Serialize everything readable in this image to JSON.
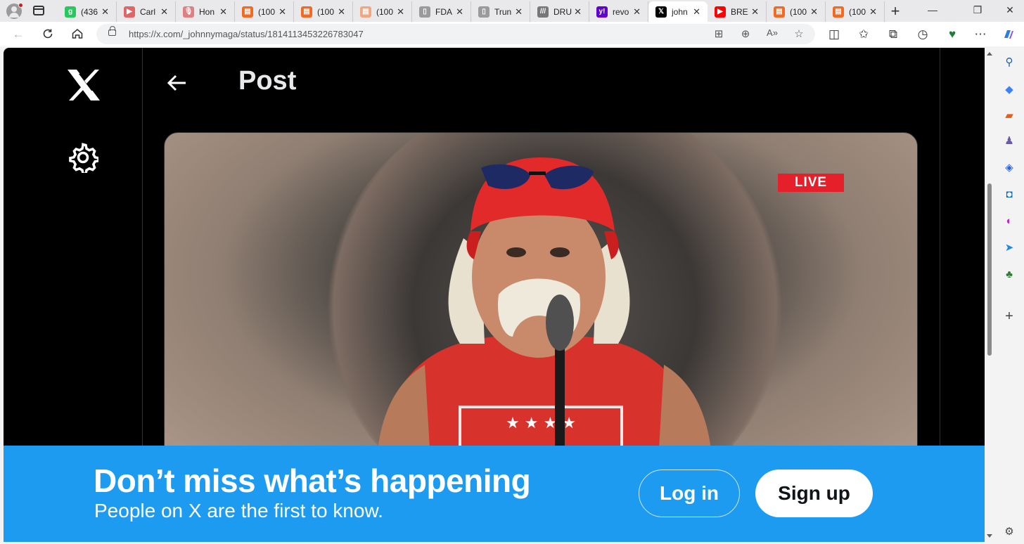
{
  "browser": {
    "tabs": [
      {
        "title": "(436",
        "favicon": "g",
        "color": "#27c95f"
      },
      {
        "title": "Carl",
        "favicon": "▶",
        "color": "#e06666"
      },
      {
        "title": "Hon",
        "favicon": "🎙",
        "color": "#e07f7f"
      },
      {
        "title": "(100",
        "favicon": "▤",
        "color": "#f26a21"
      },
      {
        "title": "(100",
        "favicon": "▤",
        "color": "#f26a21"
      },
      {
        "title": "(100",
        "favicon": "▤",
        "color": "#f0a882"
      },
      {
        "title": "FDA",
        "favicon": "▯",
        "color": "#9a9a9a"
      },
      {
        "title": "Trun",
        "favicon": "▯",
        "color": "#9a9a9a"
      },
      {
        "title": "DRU",
        "favicon": "///",
        "color": "#777777"
      },
      {
        "title": "revo",
        "favicon": "y!",
        "color": "#6001d2"
      },
      {
        "title": "john",
        "favicon": "𝕏",
        "color": "#000000",
        "active": true
      },
      {
        "title": "BRE",
        "favicon": "▶",
        "color": "#ff0000"
      },
      {
        "title": "(100",
        "favicon": "▤",
        "color": "#f26a21"
      },
      {
        "title": "(100",
        "favicon": "▤",
        "color": "#f26a21"
      }
    ],
    "new_tab": "+",
    "window_controls": {
      "minimize": "—",
      "restore": "❐",
      "close": "✕"
    },
    "url": "https://x.com/_johnnymaga/status/1814113453226783047"
  },
  "page": {
    "header_title": "Post",
    "live_badge": "LIVE",
    "banner": {
      "title": "Don’t miss what’s happening",
      "subtitle": "People on X are the first to know.",
      "login": "Log in",
      "signup": "Sign up"
    }
  },
  "colors": {
    "x_blue": "#1d9bf0",
    "live_red": "#e5202b",
    "page_bg": "#000000"
  },
  "icons": {
    "sidebar": [
      "search-icon",
      "tag-icon",
      "briefcase-icon",
      "games-icon",
      "copilot-icon",
      "outlook-icon",
      "drop-icon",
      "send-icon",
      "tree-icon",
      "add-icon",
      "settings-icon"
    ]
  }
}
